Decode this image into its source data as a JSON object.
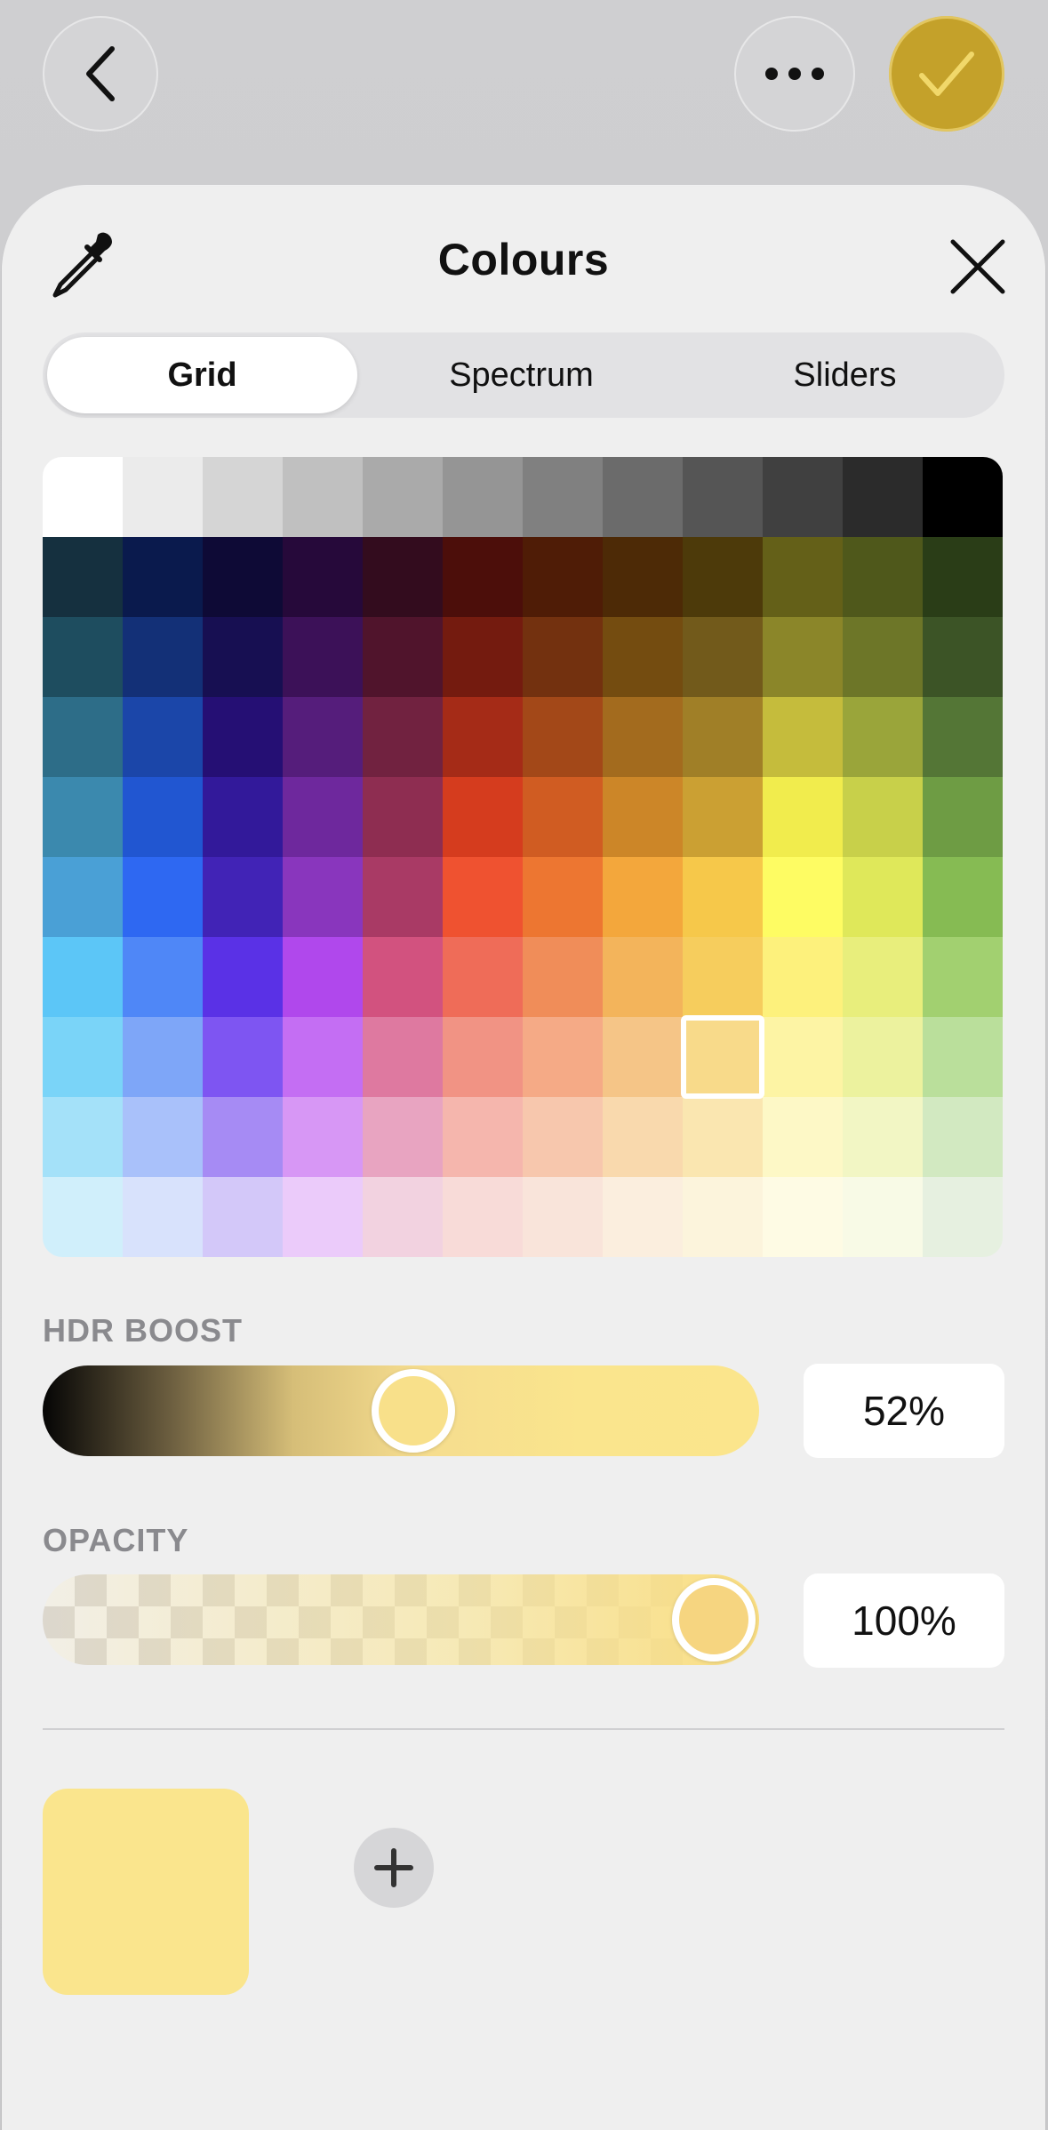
{
  "nav": {
    "back_icon": "chevron-left-icon",
    "more_icon": "ellipsis-icon",
    "done_icon": "checkmark-icon"
  },
  "colors": {
    "accent": "#c4a12a",
    "selected": "#fae58d"
  },
  "panel": {
    "title": "Colours",
    "tabs": [
      {
        "label": "Grid",
        "active": true
      },
      {
        "label": "Spectrum",
        "active": false
      },
      {
        "label": "Sliders",
        "active": false
      }
    ]
  },
  "grid": {
    "rows": [
      [
        "#ffffff",
        "#ebebeb",
        "#d5d5d5",
        "#c0c0c0",
        "#aaaaaa",
        "#959595",
        "#808080",
        "#6b6b6b",
        "#555555",
        "#404040",
        "#2b2b2b",
        "#000000"
      ],
      [
        "#15303f",
        "#0a1a4d",
        "#0e0a36",
        "#26093a",
        "#330c1e",
        "#4c0e0a",
        "#4f1c06",
        "#4d2a06",
        "#4d3a0a",
        "#646018",
        "#4f581b",
        "#2a3d17"
      ],
      [
        "#1e4d5f",
        "#133077",
        "#170f52",
        "#3c1158",
        "#50142c",
        "#741b0f",
        "#73310f",
        "#744c10",
        "#725a1b",
        "#8b8629",
        "#6d7628",
        "#3c5426"
      ],
      [
        "#2d6d88",
        "#1b46a9",
        "#250f74",
        "#551d7b",
        "#712240",
        "#a52b17",
        "#a34818",
        "#a36b1e",
        "#a07f27",
        "#c5bc3c",
        "#9aa53a",
        "#547636"
      ],
      [
        "#3b89ae",
        "#2156d1",
        "#32199a",
        "#6e289d",
        "#8e2d51",
        "#d53c1e",
        "#d05c22",
        "#cc8628",
        "#cba033",
        "#f1ec4d",
        "#c8d04a",
        "#6e9c44"
      ],
      [
        "#4aa0d6",
        "#2e68f2",
        "#4123b6",
        "#8936bd",
        "#a93a65",
        "#ef5230",
        "#ed7631",
        "#f3a73c",
        "#f6c84a",
        "#fefc63",
        "#dfe85a",
        "#86bb53"
      ],
      [
        "#5cc6f7",
        "#4f87f7",
        "#5a31e6",
        "#b048ec",
        "#d2527f",
        "#ef6c58",
        "#f08d59",
        "#f3b45b",
        "#f6cd5d",
        "#fdf17c",
        "#e8ee7c",
        "#a2d070"
      ],
      [
        "#7ad4f8",
        "#7ea6f8",
        "#7e55f2",
        "#c46ef3",
        "#de79a0",
        "#f19384",
        "#f5aa86",
        "#f5c587",
        "#f8da8a",
        "#fdf4a4",
        "#ecf29e",
        "#badf9b"
      ],
      [
        "#a4e1f9",
        "#a9c1fa",
        "#a68bf4",
        "#d797f5",
        "#e8a4c1",
        "#f5b6ad",
        "#f7c7ad",
        "#f9d9ad",
        "#fae6b0",
        "#fdf8c6",
        "#f2f6c4",
        "#d2e9c1"
      ],
      [
        "#d0effb",
        "#d8e2fc",
        "#d3c8f9",
        "#ebcbfa",
        "#f2d2e0",
        "#f8dbd8",
        "#f9e4da",
        "#fbeede",
        "#fcf4dc",
        "#fefbe4",
        "#f8fae6",
        "#e6f0e0"
      ]
    ],
    "selected_swatch": {
      "row": 7,
      "col": 8
    }
  },
  "hdr": {
    "label": "HDR BOOST",
    "value_text": "52%",
    "level": 0.52
  },
  "opacity": {
    "label": "OPACITY",
    "value_text": "100%",
    "level": 1.0
  },
  "current_color": "#fae58d",
  "add_icon": "plus-icon"
}
